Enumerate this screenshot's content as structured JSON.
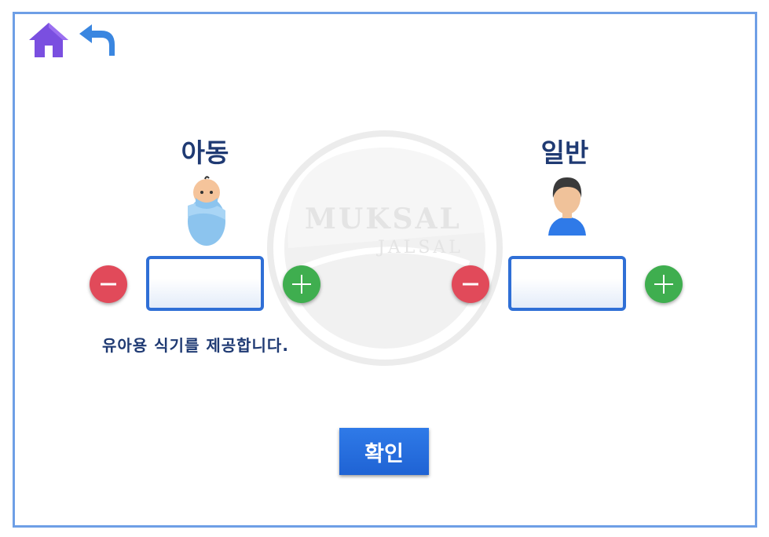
{
  "nav": {
    "home_icon": "home-icon",
    "back_icon": "back-arrow-icon"
  },
  "watermark": {
    "line1": "MUKSAL",
    "line2": "JALSAL"
  },
  "child": {
    "title": "아동",
    "icon": "baby-icon",
    "value": "",
    "decrement_icon": "minus-icon",
    "increment_icon": "plus-icon",
    "note": "유아용 식기를 제공합니다."
  },
  "adult": {
    "title": "일반",
    "icon": "person-icon",
    "value": "",
    "decrement_icon": "minus-icon",
    "increment_icon": "plus-icon"
  },
  "confirm_label": "확인",
  "colors": {
    "frame": "#6e9fe6",
    "accent": "#2f6fd6",
    "title": "#1f3a73",
    "minus": "#e14a5a",
    "plus": "#3fae4f",
    "home": "#7a4fe0"
  }
}
